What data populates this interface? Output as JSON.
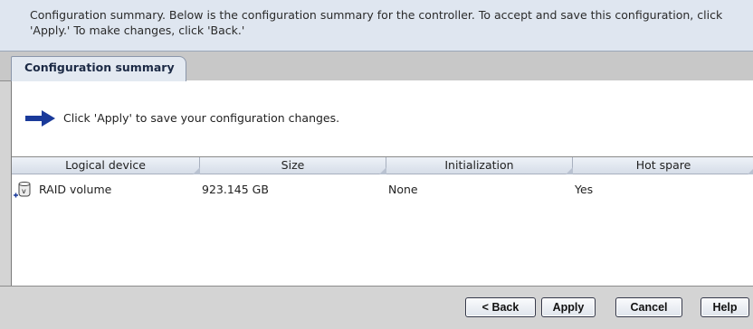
{
  "header": {
    "message": "Configuration summary. Below is the configuration summary for the controller.  To accept and save this configuration, click 'Apply.'  To make changes, click 'Back.'"
  },
  "tabs": [
    {
      "label": "Configuration summary",
      "active": true
    }
  ],
  "instruction": {
    "icon": "right-arrow-icon",
    "text": "Click 'Apply' to save your configuration changes."
  },
  "table": {
    "columns": [
      "Logical device",
      "Size",
      "Initialization",
      "Hot spare"
    ],
    "rows": [
      {
        "icon": "raid-volume-icon",
        "device": "RAID volume",
        "size": "923.145 GB",
        "initialization": "None",
        "hot_spare": "Yes"
      }
    ]
  },
  "buttons": {
    "back": "< Back",
    "apply": "Apply",
    "cancel": "Cancel",
    "help": "Help"
  },
  "colors": {
    "accent": "#1a3a9a",
    "header_bg": "#dfe6f0",
    "panel_bg": "#d4d4d4"
  }
}
